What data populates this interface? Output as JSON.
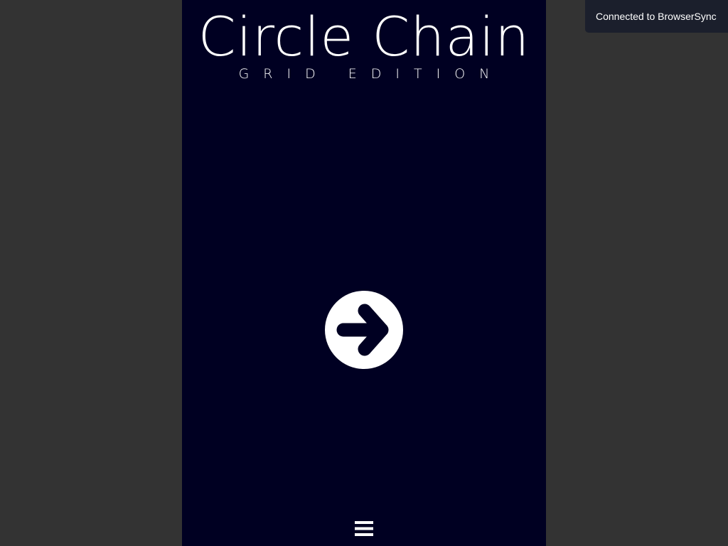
{
  "game": {
    "title": "Circle Chain",
    "subtitle": "GRID EDITION",
    "play_button": {
      "icon": "arrow-right-icon"
    },
    "menu_button": {
      "icon": "hamburger-menu-icon"
    }
  },
  "notification": {
    "text": "Connected to BrowserSync"
  },
  "colors": {
    "page_background": "#333333",
    "game_background": "#000022",
    "foreground": "#ffffff",
    "toast_background": "#1b1f2c"
  }
}
